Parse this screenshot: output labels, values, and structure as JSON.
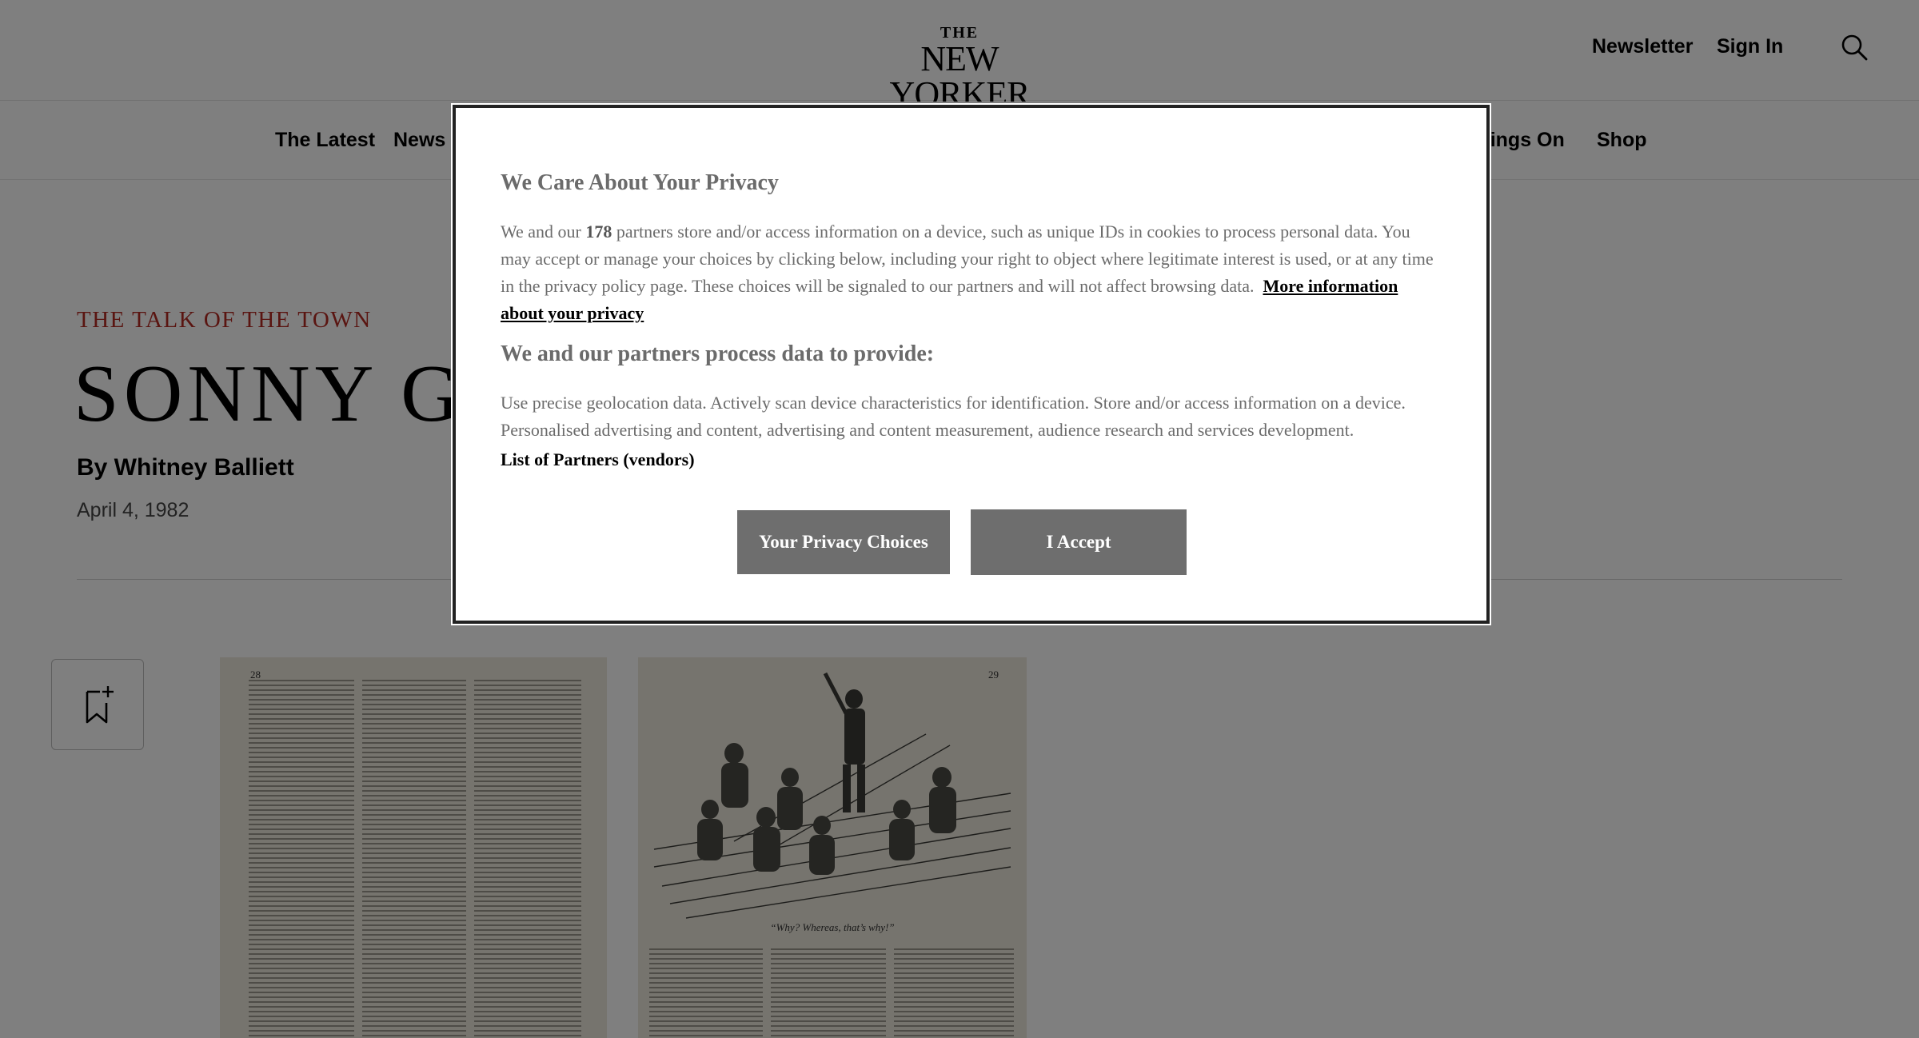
{
  "header": {
    "logo_the": "THE",
    "logo_main": "NEW YORKER",
    "newsletter_label": "Newsletter",
    "signin_label": "Sign In"
  },
  "nav": {
    "items": [
      "The Latest",
      "News",
      "Goings On",
      "Shop"
    ]
  },
  "article": {
    "rubric": "THE TALK OF THE TOWN",
    "headline": "SONNY GRE",
    "byline": "By Whitney Balliett",
    "date": "April 4, 1982",
    "scan_caption": "“Why? Whereas, that’s why!”",
    "scan_left_page_number": "28",
    "scan_right_page_number": "29"
  },
  "consent": {
    "title": "We Care About Your Privacy",
    "para_start": "We and our ",
    "partners_count": "178",
    "para_end": " partners store and/or access information on a device, such as unique IDs in cookies to process personal data. You may accept or manage your choices by clicking below, including your right to object where legitimate interest is used, or at any time in the privacy policy page. These choices will be signaled to our partners and will not affect browsing data.",
    "more_link": "More information about your privacy",
    "subtitle": "We and our partners process data to provide:",
    "purposes": "Use precise geolocation data. Actively scan device characteristics for identification. Store and/or access information on a device. Personalised advertising and content, advertising and content measurement, audience research and services development.",
    "vendors_link": "List of Partners (vendors)",
    "choices_button": "Your Privacy Choices",
    "accept_button": "I Accept"
  },
  "colors": {
    "rubric": "#b42a23",
    "overlay": "rgba(0,0,0,0.5)",
    "button_bg": "#6e6e6e"
  }
}
